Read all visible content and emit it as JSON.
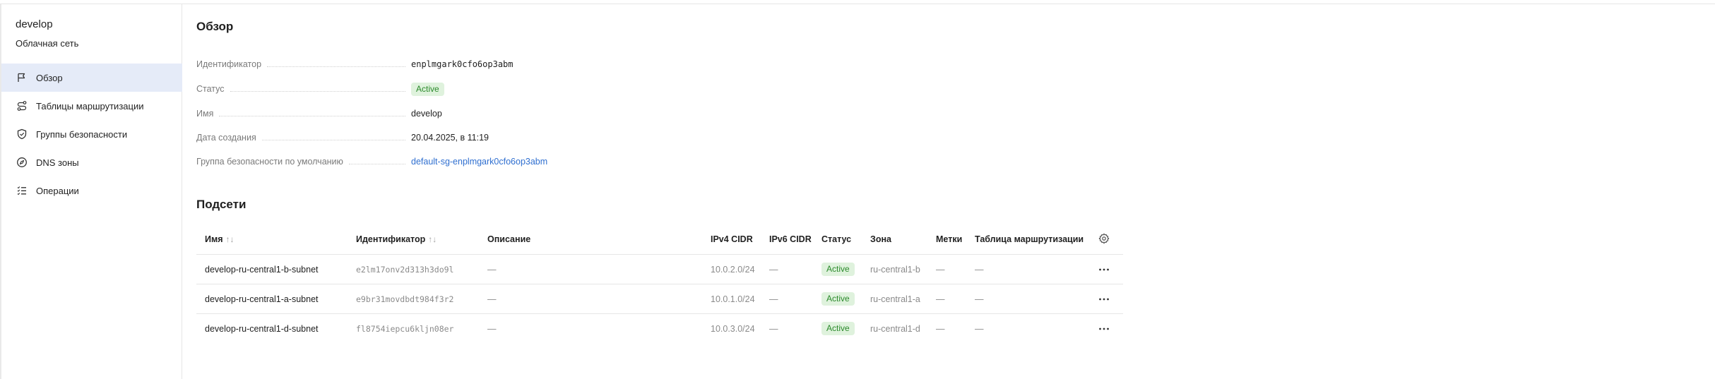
{
  "sidebar": {
    "title": "develop",
    "subtitle": "Облачная сеть",
    "items": [
      {
        "label": "Обзор",
        "icon": "flag-icon",
        "active": true
      },
      {
        "label": "Таблицы маршрутизации",
        "icon": "route-icon",
        "active": false
      },
      {
        "label": "Группы безопасности",
        "icon": "shield-icon",
        "active": false
      },
      {
        "label": "DNS зоны",
        "icon": "compass-icon",
        "active": false
      },
      {
        "label": "Операции",
        "icon": "list-icon",
        "active": false
      }
    ]
  },
  "overview": {
    "title": "Обзор",
    "fields": [
      {
        "key": "Идентификатор",
        "value": "enplmgark0cfo6op3abm"
      },
      {
        "key": "Статус",
        "value": "Active"
      },
      {
        "key": "Имя",
        "value": "develop"
      },
      {
        "key": "Дата создания",
        "value": "20.04.2025, в 11:19"
      },
      {
        "key": "Группа безопасности по умолчанию",
        "value": "default-sg-enplmgark0cfo6op3abm"
      }
    ]
  },
  "subnets": {
    "title": "Подсети",
    "columns": [
      "Имя",
      "Идентификатор",
      "Описание",
      "IPv4 CIDR",
      "IPv6 CIDR",
      "Статус",
      "Зона",
      "Метки",
      "Таблица маршрутизации"
    ],
    "sort_glyph": "↑↓",
    "dash": "—",
    "rows": [
      {
        "name": "develop-ru-central1-b-subnet",
        "id": "e2lm17onv2d313h3do9l",
        "desc": "—",
        "ipv4": "10.0.2.0/24",
        "ipv6": "—",
        "status": "Active",
        "zone": "ru-central1-b",
        "labels": "—",
        "route": "—"
      },
      {
        "name": "develop-ru-central1-a-subnet",
        "id": "e9br31movdbdt984f3r2",
        "desc": "—",
        "ipv4": "10.0.1.0/24",
        "ipv6": "—",
        "status": "Active",
        "zone": "ru-central1-a",
        "labels": "—",
        "route": "—"
      },
      {
        "name": "develop-ru-central1-d-subnet",
        "id": "fl8754iepcu6kljn08er",
        "desc": "—",
        "ipv4": "10.0.3.0/24",
        "ipv6": "—",
        "status": "Active",
        "zone": "ru-central1-d",
        "labels": "—",
        "route": "—"
      }
    ]
  },
  "colors": {
    "accent": "#2f6fd0",
    "active_bg": "#e5ebf8",
    "badge_bg": "#dff2dd",
    "badge_fg": "#2b8a2b"
  }
}
